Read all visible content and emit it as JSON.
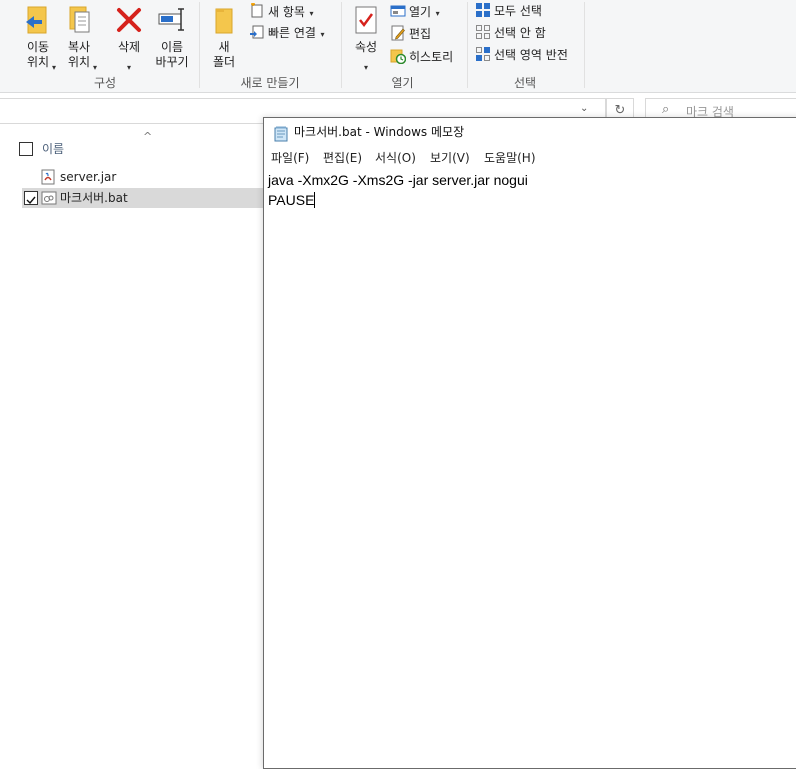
{
  "ribbon": {
    "organize": {
      "move_label": "이동\n위치",
      "copy_label": "복사\n위치",
      "delete_label": "삭제",
      "rename_label": "이름\n바꾸기",
      "group_label": "구성"
    },
    "new": {
      "new_folder_label": "새\n폴더",
      "new_item_label": "새 항목",
      "easy_access_label": "빠른 연결",
      "group_label": "새로 만들기"
    },
    "open": {
      "properties_label": "속성",
      "open_label": "열기",
      "edit_label": "편집",
      "history_label": "히스토리",
      "group_label": "열기"
    },
    "select": {
      "select_all_label": "모두 선택",
      "select_none_label": "선택 안 함",
      "invert_label": "선택 영역 반전",
      "group_label": "선택"
    }
  },
  "address": {
    "search_placeholder": "마크 검색"
  },
  "file_list": {
    "column_name": "이름",
    "files": [
      {
        "name": "server.jar",
        "checked": false
      },
      {
        "name": "마크서버.bat",
        "checked": true
      }
    ]
  },
  "notepad": {
    "title": "마크서버.bat - Windows 메모장",
    "menu": [
      "파일(F)",
      "편집(E)",
      "서식(O)",
      "보기(V)",
      "도움말(H)"
    ],
    "lines": [
      "java -Xmx2G -Xms2G -jar server.jar nogui",
      "PAUSE"
    ]
  },
  "colors": {
    "ribbon_bg": "#f5f6f7",
    "selected_row": "#d9d9d9",
    "delete_red": "#d6221c",
    "folder_yellow": "#f4c64c",
    "accent_blue": "#2a6fc9"
  }
}
